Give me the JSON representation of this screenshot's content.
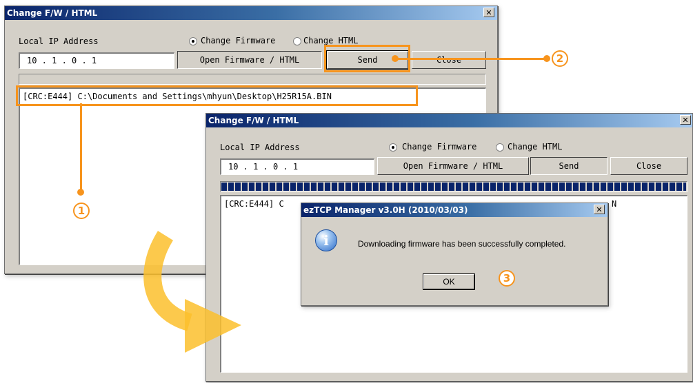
{
  "window1": {
    "title": "Change F/W / HTML",
    "close_glyph": "✕",
    "ip_label": "Local IP Address",
    "ip_value": "10 . 1 . 0 . 1",
    "radio_firmware": "Change Firmware",
    "radio_html": "Change HTML",
    "open_button": "Open Firmware / HTML",
    "send_button": "Send",
    "close_button": "Close",
    "log_line": "[CRC:E444] C:\\Documents and Settings\\mhyun\\Desktop\\H25R15A.BIN"
  },
  "window2": {
    "title": "Change F/W / HTML",
    "close_glyph": "✕",
    "ip_label": "Local IP Address",
    "ip_value": "10 . 1 . 0 . 1",
    "radio_firmware": "Change Firmware",
    "radio_html": "Change HTML",
    "open_button": "Open Firmware / HTML",
    "send_button": "Send",
    "close_button": "Close",
    "log_line_start": "[CRC:E444] C",
    "log_line_end": "N",
    "progress_percent": 100
  },
  "dialog": {
    "title": "ezTCP Manager v3.0H (2010/03/03)",
    "close_glyph": "✕",
    "info_glyph": "i",
    "message": "Downloading firmware has been successfully completed.",
    "ok_button": "OK"
  },
  "callouts": {
    "one": "1",
    "two": "2",
    "three": "3"
  },
  "colors": {
    "accent_orange": "#f7941d",
    "arrow_yellow": "#fbc02d",
    "title_blue": "#0a246a",
    "window_gray": "#d4d0c8"
  }
}
